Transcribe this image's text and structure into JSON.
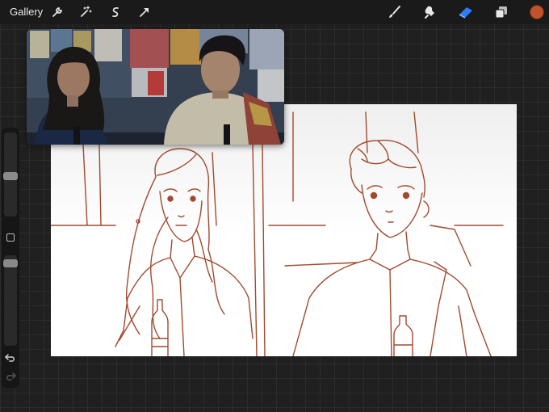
{
  "topbar": {
    "gallery_label": "Gallery",
    "left_tools": [
      "wrench-icon",
      "magic-wand-icon",
      "selection-icon",
      "transform-arrow-icon"
    ],
    "right_tools": [
      "brush-icon",
      "smudge-icon",
      "eraser-icon",
      "layers-icon",
      "color-swatch"
    ]
  },
  "colors": {
    "accent": "#2f7cf6",
    "current_color": "#c0532c",
    "line_color": "#a14a2e"
  },
  "sidebar": {
    "brush_size_level": 0.35,
    "opacity_level": 0.08,
    "tools": [
      "modify-square-icon",
      "undo-icon",
      "redo-icon"
    ]
  }
}
